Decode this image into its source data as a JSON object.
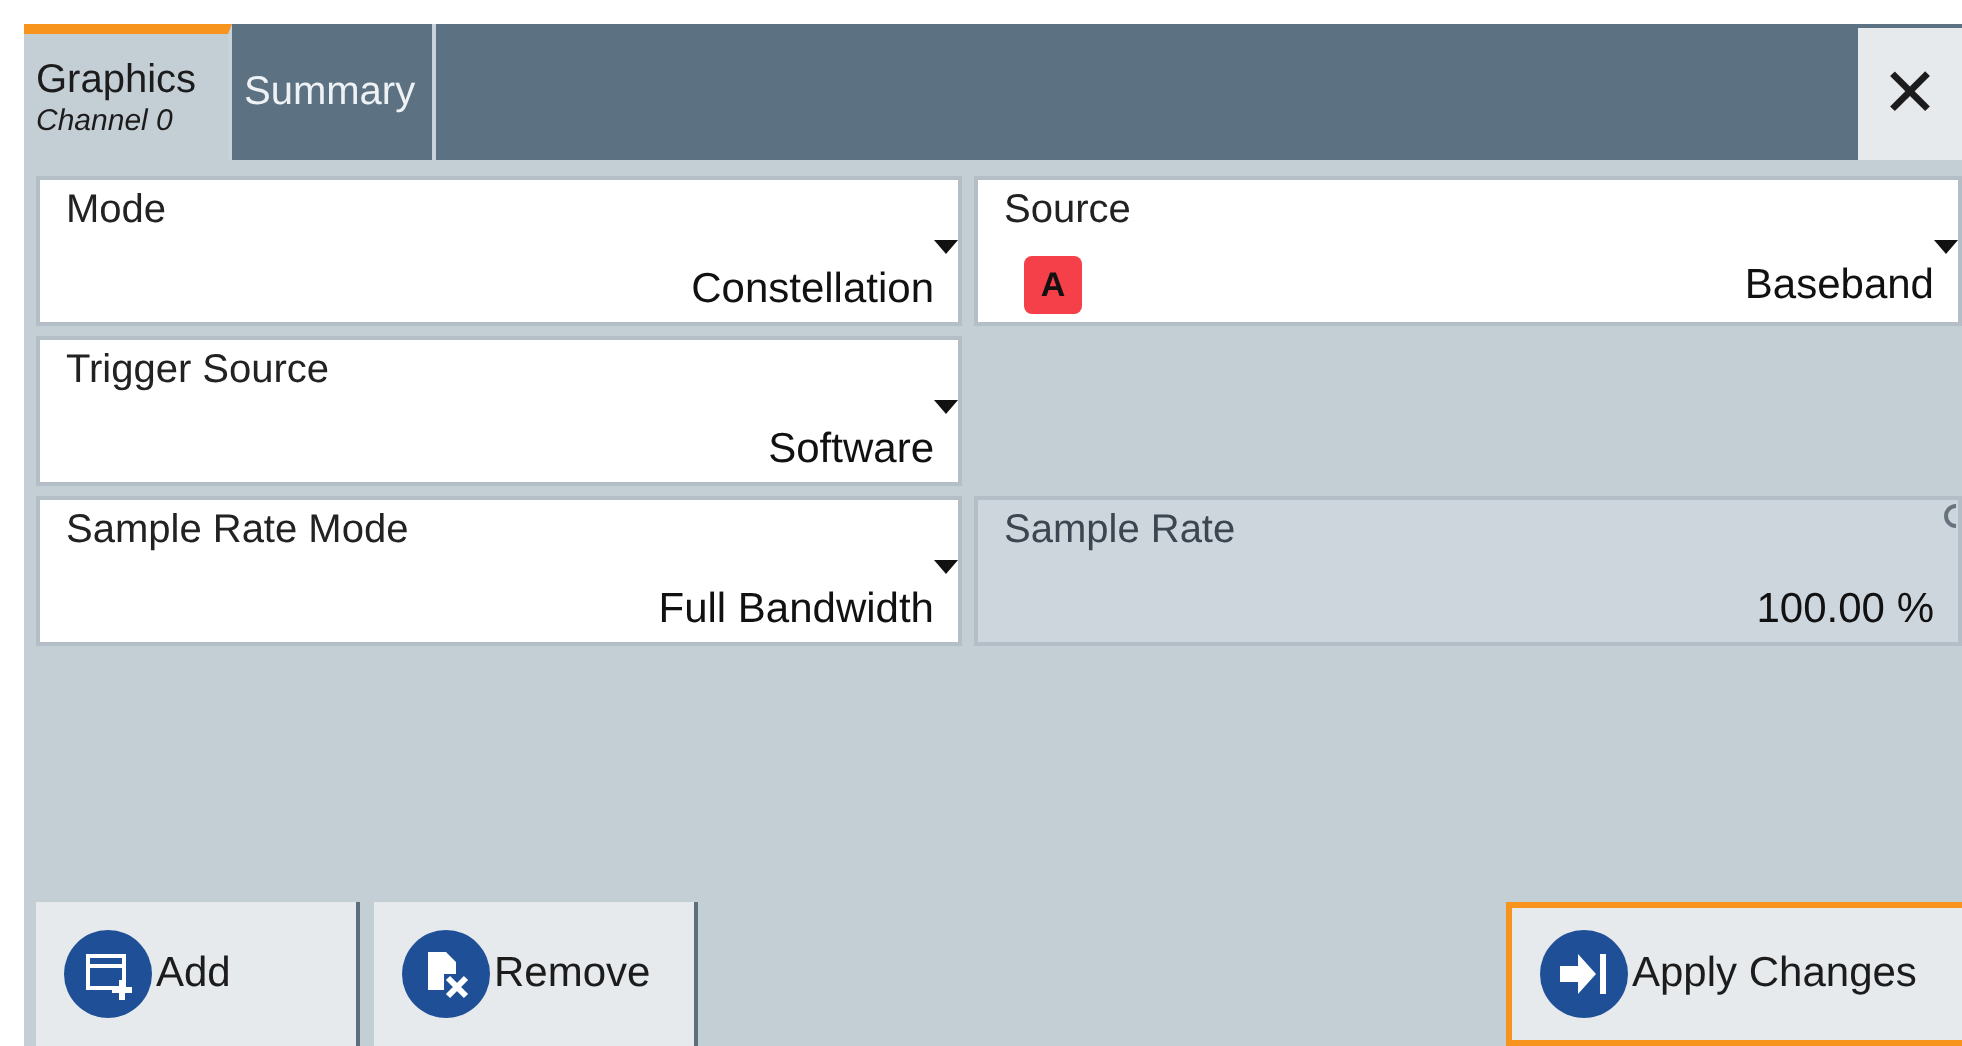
{
  "tabs": [
    {
      "label": "Graphics",
      "sublabel": "Channel 0",
      "selected": true
    },
    {
      "label": "Summary",
      "selected": false
    }
  ],
  "close_button": {
    "label": "✕"
  },
  "rows": [
    [
      {
        "label": "Mode",
        "value": "Constellation",
        "kind": "select"
      },
      {
        "label": "Source",
        "value": "Baseband",
        "kind": "select",
        "badge": "A"
      }
    ],
    [
      {
        "label": "Trigger Source",
        "value": "Software",
        "kind": "select"
      }
    ],
    [
      {
        "label": "Sample Rate Mode",
        "value": "Full Bandwidth",
        "kind": "select"
      },
      {
        "label": "Sample Rate",
        "value": "100.00 %",
        "kind": "readonly"
      }
    ]
  ],
  "buttons": [
    {
      "label": "Add",
      "kind": "add",
      "focused": false
    },
    {
      "label": "Remove",
      "kind": "remove",
      "focused": false
    },
    {
      "label": "Apply Changes",
      "kind": "apply",
      "focused": true
    }
  ]
}
